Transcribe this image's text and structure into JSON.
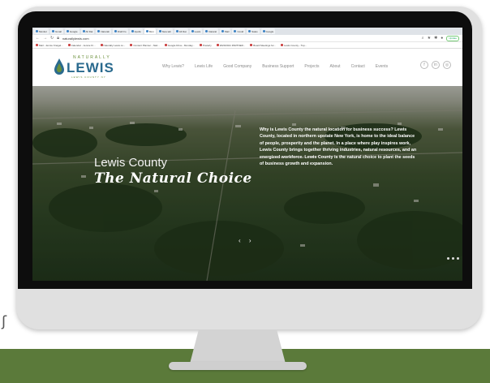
{
  "browser": {
    "tabs": [
      {
        "label": "Monitor"
      },
      {
        "label": "Gmail"
      },
      {
        "label": "Google"
      },
      {
        "label": "All Dat"
      },
      {
        "label": "Naturali"
      },
      {
        "label": "Draft Fo"
      },
      {
        "label": "Apollo"
      },
      {
        "label": "Mon"
      },
      {
        "label": "New tab"
      },
      {
        "label": "All Dat"
      },
      {
        "label": "Lewis"
      },
      {
        "label": "Natural"
      },
      {
        "label": "Mail"
      },
      {
        "label": "Covid"
      },
      {
        "label": "Sales"
      },
      {
        "label": "Google"
      }
    ],
    "url": "naturallylewis.com",
    "update_label": "Update",
    "bookmarks": [
      {
        "label": "Mail - Jennie Kreigel..."
      },
      {
        "label": "Calendar - Jennie Kr..."
      },
      {
        "label": "Naturally Lewis co..."
      },
      {
        "label": "Content Planner - Natr..."
      },
      {
        "label": "Google Drive - Monday..."
      },
      {
        "label": "Posterly"
      },
      {
        "label": "2020/2021 PARTNER..."
      },
      {
        "label": "Board Meetings for..."
      },
      {
        "label": "Lewis County - Tup..."
      }
    ]
  },
  "site": {
    "logo": {
      "top": "NATURALLY",
      "main": "LEWIS",
      "sub": "LEWIS COUNTY NY"
    },
    "nav": [
      "Why Lewis?",
      "Lewis Life",
      "Good Company",
      "Business Support",
      "Projects",
      "About",
      "Contact",
      "Events"
    ],
    "social": [
      "f",
      "in",
      "◎"
    ]
  },
  "hero": {
    "title_line1": "Lewis County",
    "title_line2": "The Natural Choice",
    "body": "Why is Lewis County the natural location for business success? Lewis County, located in northern upstate New York, is home to the ideal balance of people, prosperity and the planet. In a place where play inspires work, Lewis County brings together thriving industries, natural resources, and an energized workforce. Lewis County is the natural choice to plant the seeds of business growth and expansion.",
    "arrows": "‹ ›"
  },
  "colors": {
    "logo_blue": "#2a6a8e",
    "logo_green": "#6a8f3a",
    "footer_green": "#5b7a3a"
  }
}
